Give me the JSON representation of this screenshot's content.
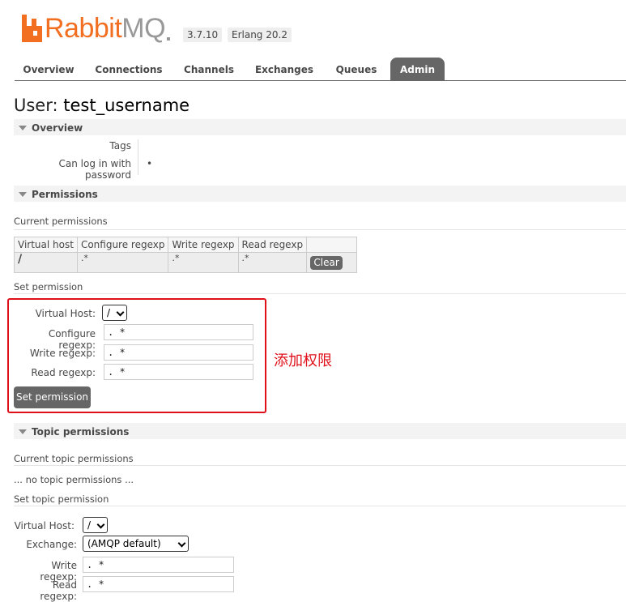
{
  "brand": {
    "name_rabbit": "Rabbit",
    "name_mq": "MQ",
    "version": "3.7.10",
    "erlang": "Erlang 20.2",
    "accent": "#f26f21"
  },
  "tabs": [
    {
      "label": "Overview",
      "active": false
    },
    {
      "label": "Connections",
      "active": false
    },
    {
      "label": "Channels",
      "active": false
    },
    {
      "label": "Exchanges",
      "active": false
    },
    {
      "label": "Queues",
      "active": false
    },
    {
      "label": "Admin",
      "active": true
    }
  ],
  "page": {
    "title_prefix": "User:",
    "username": "test_username"
  },
  "overview": {
    "heading": "Overview",
    "tags_label": "Tags",
    "tags_value": "",
    "login_label": "Can log in with password",
    "login_value": "•"
  },
  "permissions": {
    "heading": "Permissions",
    "current_label": "Current permissions",
    "columns": [
      "Virtual host",
      "Configure regexp",
      "Write regexp",
      "Read regexp"
    ],
    "rows": [
      {
        "vhost": "/",
        "configure": ".*",
        "write": ".*",
        "read": ".*",
        "action": "Clear"
      }
    ],
    "set_label": "Set permission",
    "form": {
      "vhost_label": "Virtual Host:",
      "vhost_value": "/",
      "configure_label": "Configure regexp:",
      "configure_value": ". *",
      "write_label": "Write regexp:",
      "write_value": ". *",
      "read_label": "Read regexp:",
      "read_value": ". *",
      "submit": "Set permission"
    },
    "annotation": "添加权限",
    "annotation_color": "#e0101a"
  },
  "topic_permissions": {
    "heading": "Topic permissions",
    "current_label": "Current topic permissions",
    "empty_text": "... no topic permissions ...",
    "set_label": "Set topic permission",
    "form": {
      "vhost_label": "Virtual Host:",
      "vhost_value": "/",
      "exchange_label": "Exchange:",
      "exchange_value": "(AMQP default)",
      "write_label": "Write regexp:",
      "write_value": ". *",
      "read_label": "Read regexp:",
      "read_value": ". *"
    }
  }
}
